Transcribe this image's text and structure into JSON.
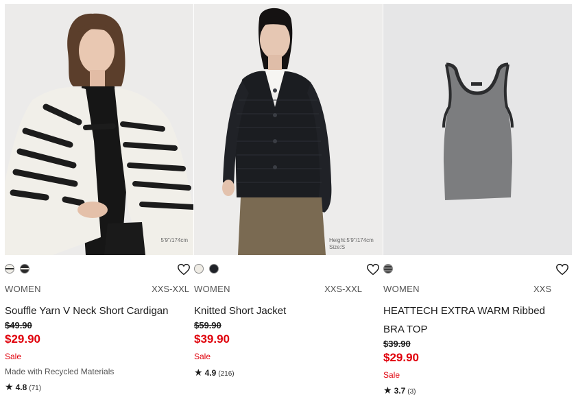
{
  "products": [
    {
      "name": "Souffle Yarn V Neck Short Cardigan",
      "gender": "WOMEN",
      "sizes": "XXS-XXL",
      "original_price": "$49.90",
      "sale_price": "$29.90",
      "sale_label": "Sale",
      "note": "Made with Recycled Materials",
      "rating": "4.8",
      "review_count": "(71)",
      "image_caption": "5'9\"/174cm",
      "swatches": [
        "#f2f0ea",
        "#2a2a2a"
      ],
      "image_icon": "model-striped-cardigan-photo"
    },
    {
      "name": "Knitted Short Jacket",
      "gender": "WOMEN",
      "sizes": "XXS-XXL",
      "original_price": "$59.90",
      "sale_price": "$39.90",
      "sale_label": "Sale",
      "rating": "4.9",
      "review_count": "(216)",
      "image_caption_1": "Height:5'9\"/174cm",
      "image_caption_2": "Size:S",
      "swatches": [
        "#efece5",
        "#1f2228"
      ],
      "image_icon": "model-black-jacket-photo"
    },
    {
      "name": "HEATTECH EXTRA WARM Ribbed BRA TOP",
      "gender": "WOMEN",
      "sizes": "XXS",
      "original_price": "$39.90",
      "sale_price": "$29.90",
      "sale_label": "Sale",
      "rating": "3.7",
      "review_count": "(3)",
      "swatches": [
        "#5a5a5a"
      ],
      "image_icon": "grey-tank-top-photo"
    }
  ],
  "colors": {
    "sale_red": "#e0000b",
    "text": "#1b1b1b",
    "muted": "#555555"
  }
}
